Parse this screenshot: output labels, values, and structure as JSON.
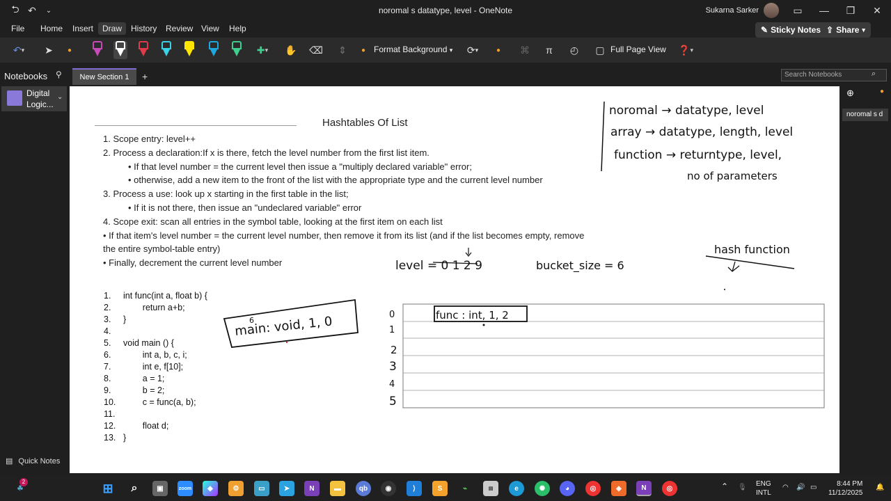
{
  "window": {
    "title": "noromal s datatype, level  -  OneNote",
    "user": "Sukarna Sarker"
  },
  "menu": {
    "items": [
      "File",
      "Home",
      "Insert",
      "Draw",
      "History",
      "Review",
      "View",
      "Help"
    ],
    "active": "Draw",
    "sticky_notes": "Sticky Notes",
    "share": "Share"
  },
  "toolbar": {
    "format_background": "Format Background",
    "full_page_view": "Full Page View",
    "pen_colors": [
      "#c64ab8",
      "#ffffff",
      "#e03a4a",
      "#3ad0e6",
      "#ffe600",
      "#1ea8e0",
      "#3ecf8e"
    ]
  },
  "nav": {
    "notebooks_label": "Notebooks",
    "section_tab": "New Section 1",
    "search_placeholder": "Search Notebooks",
    "notebook_name": "Digital Logic...",
    "quick_notes": "Quick Notes",
    "page_tab": "noromal s d"
  },
  "page": {
    "title": "Hashtables Of List",
    "notes": [
      {
        "text": "1. Scope entry: level++",
        "indent": false
      },
      {
        "text": "2. Process a declaration:If x is there, fetch the level number from the first list item.",
        "indent": false
      },
      {
        "text": "• If that level number = the current level then issue a \"multiply declared variable\" error;",
        "indent": true
      },
      {
        "text": "• otherwise, add a new item to the front of the list with the appropriate type and the current level number",
        "indent": true
      },
      {
        "text": "3. Process a use: look up x starting in the first table in the list;",
        "indent": false
      },
      {
        "text": "• If it is not there, then issue an \"undeclared variable\" error",
        "indent": true
      },
      {
        "text": "4. Scope exit: scan all entries in the symbol table, looking at the first item on each list",
        "indent": false
      },
      {
        "text": "• If that item's level number = the current level number, then remove it from its list (and if the list becomes empty, remove",
        "indent": false
      },
      {
        "text": "the entire symbol-table entry)",
        "indent": false
      },
      {
        "text": "• Finally, decrement the current level number",
        "indent": false
      }
    ],
    "code": [
      {
        "n": "1.",
        "text": "int func(int a, float b) {"
      },
      {
        "n": "2.",
        "text": "        return a+b;"
      },
      {
        "n": "3.",
        "text": "}"
      },
      {
        "n": "4.",
        "text": ""
      },
      {
        "n": "5.",
        "text": "void main () {"
      },
      {
        "n": "6.",
        "text": "        int a, b, c, i;"
      },
      {
        "n": "7.",
        "text": "        int e, f[10];"
      },
      {
        "n": "8.",
        "text": "        a = 1;"
      },
      {
        "n": "9.",
        "text": "        b = 2;"
      },
      {
        "n": "10.",
        "text": "        c = func(a, b);"
      },
      {
        "n": "11.",
        "text": ""
      },
      {
        "n": "12.",
        "text": "        float d;"
      },
      {
        "n": "13.",
        "text": "}"
      }
    ],
    "handwriting": {
      "row1": "noromal → datatype, level",
      "row2": "array → datatype, length, level",
      "row3": "function → returntype, level,",
      "row3b": "no of parameters",
      "hash": "hash function",
      "level": "level = 0 1 2 9",
      "bucket": "bucket_size = 6",
      "main_box": "main: void, 1, 0",
      "main_super": "6",
      "func_box": "func : int, 1, 2",
      "indices": [
        "0",
        "1",
        "2",
        "3",
        "4",
        "5"
      ]
    }
  },
  "taskbar": {
    "lang1": "ENG",
    "lang2": "INTL",
    "time": "8:44 PM",
    "date": "11/12/2025",
    "badge": "2"
  }
}
